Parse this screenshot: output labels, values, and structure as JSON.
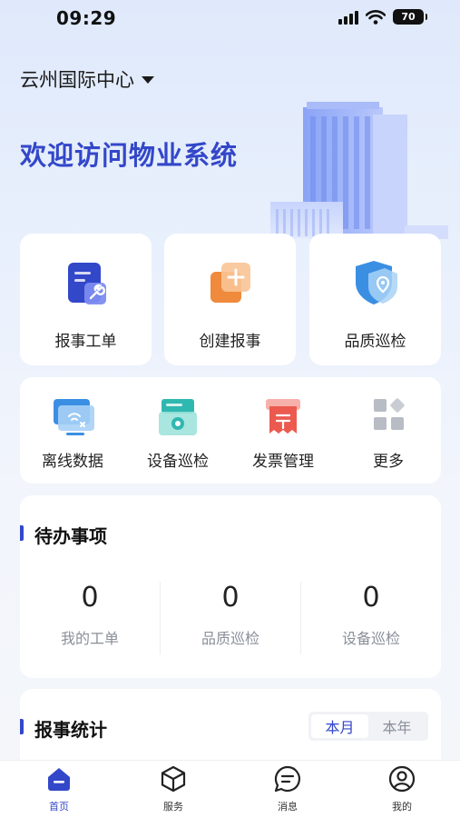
{
  "status_bar": {
    "time": "09:29",
    "battery": "70"
  },
  "header": {
    "location": "云州国际中心",
    "welcome": "欢迎访问物业系统"
  },
  "quick_actions": [
    {
      "label": "报事工单",
      "icon": "work-order-icon"
    },
    {
      "label": "创建报事",
      "icon": "create-report-icon"
    },
    {
      "label": "品质巡检",
      "icon": "quality-inspection-icon"
    }
  ],
  "tools": [
    {
      "label": "离线数据",
      "icon": "offline-data-icon"
    },
    {
      "label": "设备巡检",
      "icon": "device-inspection-icon"
    },
    {
      "label": "发票管理",
      "icon": "invoice-icon"
    },
    {
      "label": "更多",
      "icon": "more-grid-icon"
    }
  ],
  "todo": {
    "title": "待办事项",
    "stats": [
      {
        "value": "0",
        "label": "我的工单"
      },
      {
        "value": "0",
        "label": "品质巡检"
      },
      {
        "value": "0",
        "label": "设备巡检"
      }
    ]
  },
  "report_stats": {
    "title": "报事统计",
    "periods": [
      "本月",
      "本年"
    ],
    "selected": "本月"
  },
  "tabbar": [
    {
      "label": "首页",
      "icon": "home-icon",
      "active": true
    },
    {
      "label": "服务",
      "icon": "service-cube-icon",
      "active": false
    },
    {
      "label": "消息",
      "icon": "message-icon",
      "active": false
    },
    {
      "label": "我的",
      "icon": "profile-icon",
      "active": false
    }
  ],
  "colors": {
    "accent": "#3347c9",
    "orange": "#f08a3c",
    "red": "#ec5a4f",
    "teal": "#2fb8b0"
  }
}
